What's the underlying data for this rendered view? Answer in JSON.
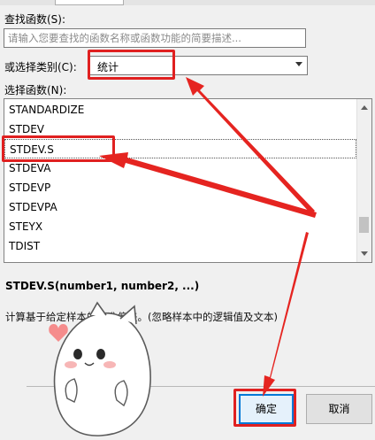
{
  "search": {
    "label": "查找函数(S):",
    "placeholder": "请输入您要查找的函数名称或函数功能的简要描述..."
  },
  "category": {
    "label": "或选择类别(C):",
    "value": "统计"
  },
  "function_list": {
    "label": "选择函数(N):",
    "items": [
      "STANDARDIZE",
      "STDEV",
      "STDEV.S",
      "STDEVA",
      "STDEVP",
      "STDEVPA",
      "STEYX",
      "TDIST"
    ],
    "selected": "STDEV.S"
  },
  "selected_function": {
    "signature": "STDEV.S(number1, number2, ...)",
    "description": "计算基于给定样本的标准偏差。(忽略样本中的逻辑值及文本)"
  },
  "buttons": {
    "ok": "确定",
    "cancel": "取消"
  },
  "colors": {
    "annotation_red": "#e02020",
    "selection_border": "#555555",
    "ok_border": "#0078d7"
  }
}
